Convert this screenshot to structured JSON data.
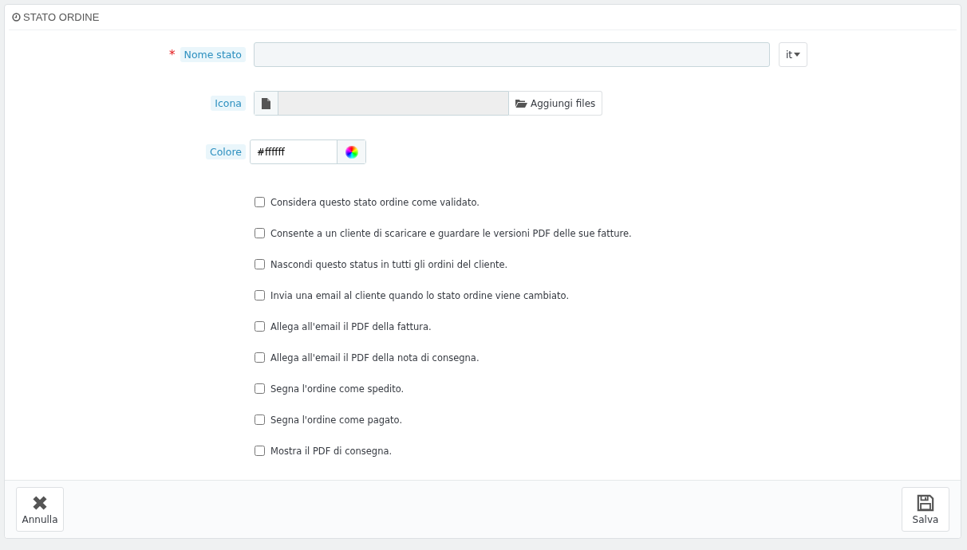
{
  "panel": {
    "title": "STATO ORDINE"
  },
  "fields": [
    {
      "kind": "text",
      "marker": "*",
      "label": "Nome stato",
      "language": "it"
    },
    {
      "kind": "file",
      "label": "Icona",
      "button": "Aggiungi files"
    },
    {
      "kind": "color",
      "label": "Colore",
      "value": "#ffffff"
    }
  ],
  "options": [
    {
      "label": "Considera questo stato ordine come validato.",
      "checked": false
    },
    {
      "label": "Consente a un cliente di scaricare e guardare le versioni PDF delle sue fatture.",
      "checked": false
    },
    {
      "label": "Nascondi questo status in tutti gli ordini del cliente.",
      "checked": false
    },
    {
      "label": "Invia una email al cliente quando lo stato ordine viene cambiato.",
      "checked": false
    },
    {
      "label": "Allega all'email il PDF della fattura.",
      "checked": false
    },
    {
      "label": "Allega all'email il PDF della nota di consegna.",
      "checked": false
    },
    {
      "label": "Segna l'ordine come spedito.",
      "checked": false
    },
    {
      "label": "Segna l'ordine come pagato.",
      "checked": false
    },
    {
      "label": "Mostra il PDF di consegna.",
      "checked": false
    }
  ],
  "footer": {
    "cancel": "Annulla",
    "save": "Salva"
  }
}
